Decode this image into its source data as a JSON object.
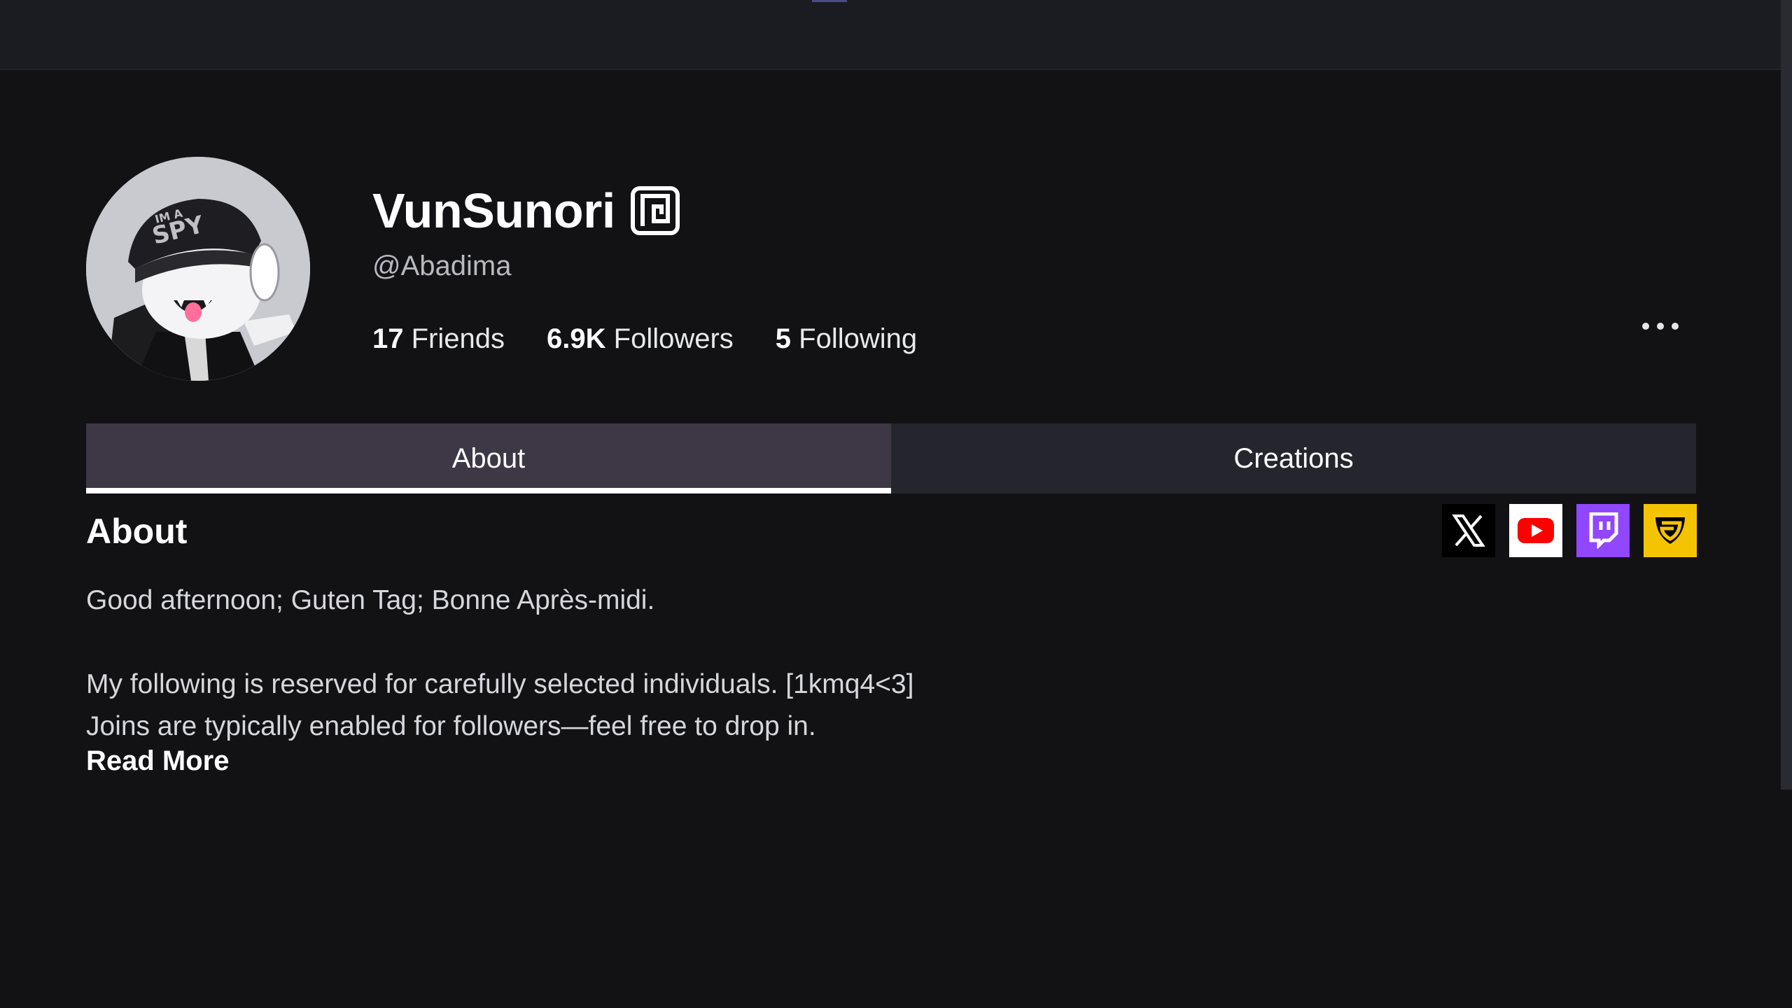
{
  "profile": {
    "display_name": "VunSunori",
    "username": "@Abadima",
    "verified_icon": "premium-badge-icon",
    "avatar_alt": "avatar"
  },
  "stats": [
    {
      "count": "17",
      "label": "Friends"
    },
    {
      "count": "6.9K",
      "label": "Followers"
    },
    {
      "count": "5",
      "label": "Following"
    }
  ],
  "menu": {
    "icon": "more-options-icon"
  },
  "tabs": [
    {
      "label": "About",
      "active": true
    },
    {
      "label": "Creations",
      "active": false
    }
  ],
  "about": {
    "title": "About",
    "lines": [
      "Good afternoon; Guten Tag; Bonne Après-midi.",
      "",
      "My following is reserved for carefully selected individuals. [1kmq4<3]",
      "Joins are typically enabled for followers—feel free to drop in."
    ],
    "read_more": "Read More"
  },
  "social_links": [
    {
      "icon": "x-twitter-icon",
      "color": "#000000"
    },
    {
      "icon": "youtube-icon",
      "color": "#ffffff"
    },
    {
      "icon": "twitch-icon",
      "color": "#9146ff"
    },
    {
      "icon": "guilded-icon",
      "color": "#f5c400"
    }
  ],
  "colors": {
    "background": "#121215",
    "topbar": "#1b1c21",
    "tab_active": "#3d3746",
    "tab_inactive": "#25262d"
  }
}
